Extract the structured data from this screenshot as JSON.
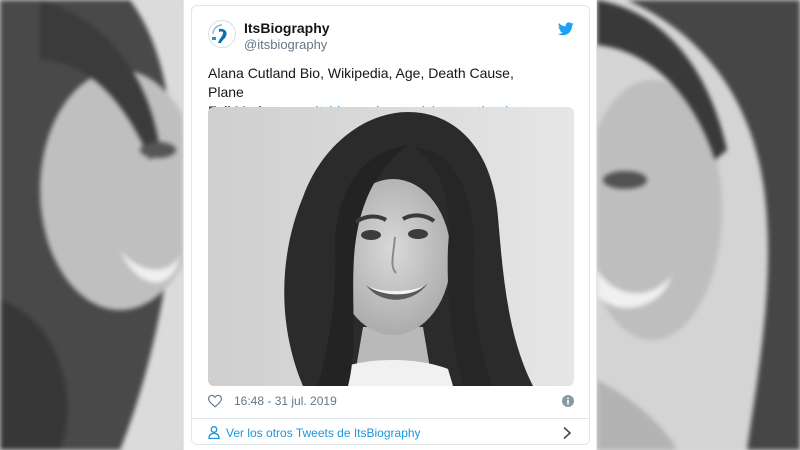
{
  "tweet": {
    "display_name": "ItsBiography",
    "handle": "@itsbiography",
    "text_line1": "Alana Cutland Bio, Wikipedia, Age, Death Cause, Plane",
    "text_line2_prefix": "Fall Madagascar ",
    "link_text": "itsbiography.com/alana-cutland-...",
    "timestamp": "16:48 - 31 jul. 2019",
    "footer_link": "Ver los otros Tweets de ItsBiography"
  },
  "icons": {
    "avatar": "itsbiography-logo",
    "brand": "twitter-bird-icon",
    "like": "heart-icon",
    "info": "info-icon",
    "profile": "person-icon",
    "next": "chevron-right-icon"
  },
  "colors": {
    "link": "#1b95e0",
    "text": "#14171a",
    "muted": "#657786",
    "border": "#e1e8ed"
  }
}
